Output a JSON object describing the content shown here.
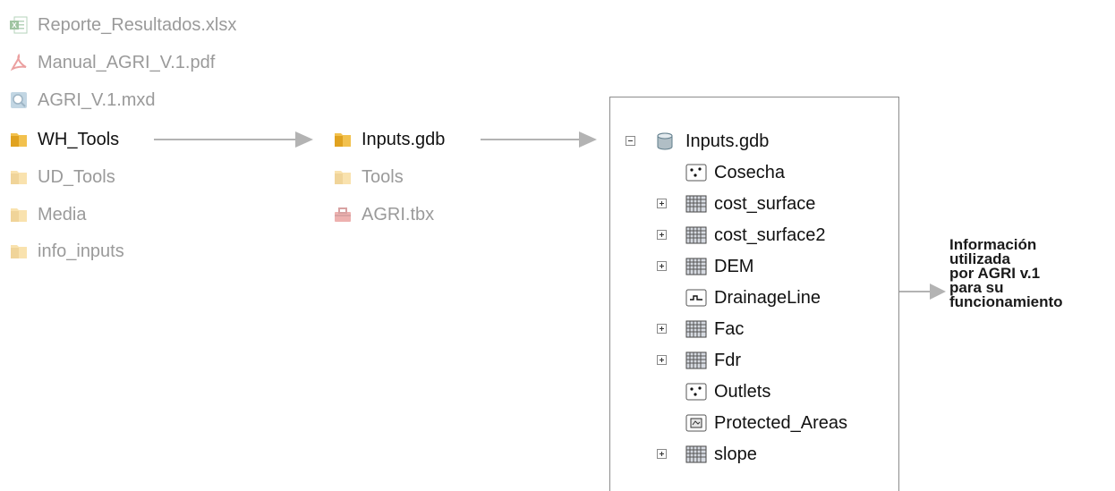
{
  "explorer_left": {
    "items": [
      {
        "label": "Reporte_Resultados.xlsx",
        "icon": "excel-file-icon",
        "state": "dimmed"
      },
      {
        "label": "Manual_AGRI_V.1.pdf",
        "icon": "pdf-file-icon",
        "state": "dimmed"
      },
      {
        "label": "AGRI_V.1.mxd",
        "icon": "arcmap-document-icon",
        "state": "dimmed"
      },
      {
        "label": "WH_Tools",
        "icon": "folder-icon",
        "state": "highlighted"
      },
      {
        "label": "UD_Tools",
        "icon": "folder-icon",
        "state": "dimmed"
      },
      {
        "label": "Media",
        "icon": "folder-icon",
        "state": "dimmed"
      },
      {
        "label": "info_inputs",
        "icon": "folder-icon",
        "state": "dimmed"
      }
    ]
  },
  "explorer_middle": {
    "items": [
      {
        "label": "Inputs.gdb",
        "icon": "folder-icon",
        "state": "highlighted"
      },
      {
        "label": "Tools",
        "icon": "folder-icon",
        "state": "dimmed"
      },
      {
        "label": "AGRI.tbx",
        "icon": "toolbox-icon",
        "state": "dimmed"
      }
    ]
  },
  "catalog_tree": {
    "root": {
      "label": "Inputs.gdb",
      "icon": "database-icon",
      "expanded": true
    },
    "children": [
      {
        "label": "Cosecha",
        "type": "point-feature-class-icon",
        "expandable": false
      },
      {
        "label": "cost_surface",
        "type": "raster-dataset-icon",
        "expandable": true
      },
      {
        "label": "cost_surface2",
        "type": "raster-dataset-icon",
        "expandable": true
      },
      {
        "label": "DEM",
        "type": "raster-dataset-icon",
        "expandable": true
      },
      {
        "label": "DrainageLine",
        "type": "line-feature-class-icon",
        "expandable": false
      },
      {
        "label": "Fac",
        "type": "raster-dataset-icon",
        "expandable": true
      },
      {
        "label": "Fdr",
        "type": "raster-dataset-icon",
        "expandable": true
      },
      {
        "label": "Outlets",
        "type": "point-feature-class-icon",
        "expandable": false
      },
      {
        "label": "Protected_Areas",
        "type": "polygon-feature-class-icon",
        "expandable": false
      },
      {
        "label": "slope",
        "type": "raster-dataset-icon",
        "expandable": true
      }
    ]
  },
  "annotation": {
    "lines": [
      "Información",
      "utilizada",
      "por AGRI v.1",
      "para su",
      "funcionamiento"
    ]
  },
  "colors": {
    "arrow": "#b3b3b3",
    "dim_text": "#9a9a9a",
    "text": "#111111",
    "folder": "#e8b53a"
  }
}
